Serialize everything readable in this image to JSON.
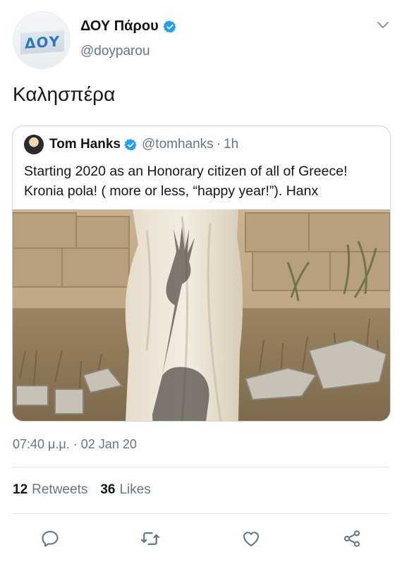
{
  "author": {
    "name": "ΔΟΥ Πάρου",
    "handle": "@doyparou",
    "avatar_text": "ΔΟΥ",
    "verified": true
  },
  "tweet": {
    "text": "Καλησπέρα",
    "timestamp": "07:40 μ.μ. · 02 Jan 20"
  },
  "quoted_tweet": {
    "author_name": "Tom Hanks",
    "author_handle": "@tomhanks",
    "separator": "·",
    "time_ago": "1h",
    "verified": true,
    "text": "Starting 2020 as an Honorary citizen of all of Greece! Kronia pola! ( more or less, “happy year!”). Hanx"
  },
  "stats": {
    "retweets_count": "12",
    "retweets_label": "Retweets",
    "likes_count": "36",
    "likes_label": "Likes"
  },
  "icons": {
    "reply": "reply-icon",
    "retweet": "retweet-icon",
    "like": "heart-icon",
    "share": "share-icon",
    "more": "chevron-down-icon",
    "verified": "verified-badge-icon"
  },
  "colors": {
    "verified_blue": "#1da1f2",
    "secondary_text": "#657786",
    "avatar_blue": "#2f78bf"
  }
}
